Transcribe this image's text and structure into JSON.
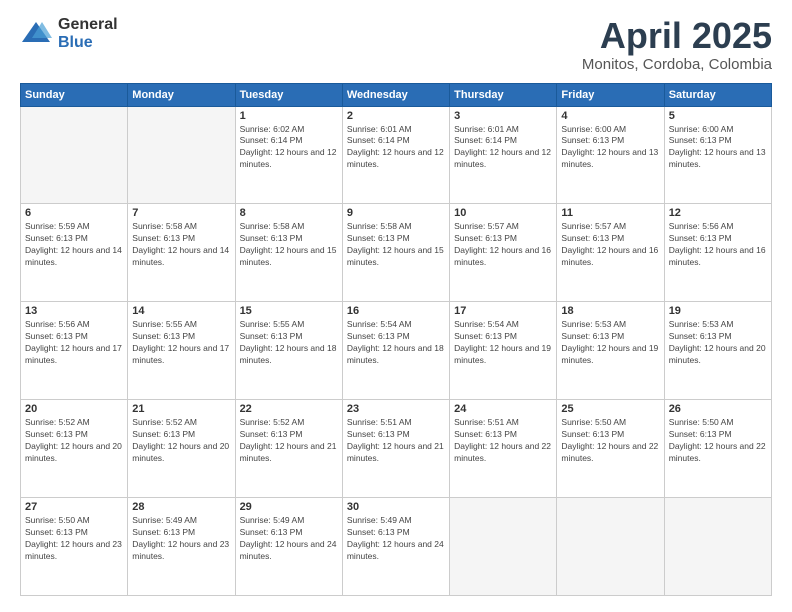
{
  "logo": {
    "general": "General",
    "blue": "Blue"
  },
  "header": {
    "month": "April 2025",
    "location": "Monitos, Cordoba, Colombia"
  },
  "weekdays": [
    "Sunday",
    "Monday",
    "Tuesday",
    "Wednesday",
    "Thursday",
    "Friday",
    "Saturday"
  ],
  "days": [
    {
      "date": "",
      "sunrise": "",
      "sunset": "",
      "daylight": ""
    },
    {
      "date": "",
      "sunrise": "",
      "sunset": "",
      "daylight": ""
    },
    {
      "date": "1",
      "sunrise": "Sunrise: 6:02 AM",
      "sunset": "Sunset: 6:14 PM",
      "daylight": "Daylight: 12 hours and 12 minutes."
    },
    {
      "date": "2",
      "sunrise": "Sunrise: 6:01 AM",
      "sunset": "Sunset: 6:14 PM",
      "daylight": "Daylight: 12 hours and 12 minutes."
    },
    {
      "date": "3",
      "sunrise": "Sunrise: 6:01 AM",
      "sunset": "Sunset: 6:14 PM",
      "daylight": "Daylight: 12 hours and 12 minutes."
    },
    {
      "date": "4",
      "sunrise": "Sunrise: 6:00 AM",
      "sunset": "Sunset: 6:13 PM",
      "daylight": "Daylight: 12 hours and 13 minutes."
    },
    {
      "date": "5",
      "sunrise": "Sunrise: 6:00 AM",
      "sunset": "Sunset: 6:13 PM",
      "daylight": "Daylight: 12 hours and 13 minutes."
    },
    {
      "date": "6",
      "sunrise": "Sunrise: 5:59 AM",
      "sunset": "Sunset: 6:13 PM",
      "daylight": "Daylight: 12 hours and 14 minutes."
    },
    {
      "date": "7",
      "sunrise": "Sunrise: 5:58 AM",
      "sunset": "Sunset: 6:13 PM",
      "daylight": "Daylight: 12 hours and 14 minutes."
    },
    {
      "date": "8",
      "sunrise": "Sunrise: 5:58 AM",
      "sunset": "Sunset: 6:13 PM",
      "daylight": "Daylight: 12 hours and 15 minutes."
    },
    {
      "date": "9",
      "sunrise": "Sunrise: 5:58 AM",
      "sunset": "Sunset: 6:13 PM",
      "daylight": "Daylight: 12 hours and 15 minutes."
    },
    {
      "date": "10",
      "sunrise": "Sunrise: 5:57 AM",
      "sunset": "Sunset: 6:13 PM",
      "daylight": "Daylight: 12 hours and 16 minutes."
    },
    {
      "date": "11",
      "sunrise": "Sunrise: 5:57 AM",
      "sunset": "Sunset: 6:13 PM",
      "daylight": "Daylight: 12 hours and 16 minutes."
    },
    {
      "date": "12",
      "sunrise": "Sunrise: 5:56 AM",
      "sunset": "Sunset: 6:13 PM",
      "daylight": "Daylight: 12 hours and 16 minutes."
    },
    {
      "date": "13",
      "sunrise": "Sunrise: 5:56 AM",
      "sunset": "Sunset: 6:13 PM",
      "daylight": "Daylight: 12 hours and 17 minutes."
    },
    {
      "date": "14",
      "sunrise": "Sunrise: 5:55 AM",
      "sunset": "Sunset: 6:13 PM",
      "daylight": "Daylight: 12 hours and 17 minutes."
    },
    {
      "date": "15",
      "sunrise": "Sunrise: 5:55 AM",
      "sunset": "Sunset: 6:13 PM",
      "daylight": "Daylight: 12 hours and 18 minutes."
    },
    {
      "date": "16",
      "sunrise": "Sunrise: 5:54 AM",
      "sunset": "Sunset: 6:13 PM",
      "daylight": "Daylight: 12 hours and 18 minutes."
    },
    {
      "date": "17",
      "sunrise": "Sunrise: 5:54 AM",
      "sunset": "Sunset: 6:13 PM",
      "daylight": "Daylight: 12 hours and 19 minutes."
    },
    {
      "date": "18",
      "sunrise": "Sunrise: 5:53 AM",
      "sunset": "Sunset: 6:13 PM",
      "daylight": "Daylight: 12 hours and 19 minutes."
    },
    {
      "date": "19",
      "sunrise": "Sunrise: 5:53 AM",
      "sunset": "Sunset: 6:13 PM",
      "daylight": "Daylight: 12 hours and 20 minutes."
    },
    {
      "date": "20",
      "sunrise": "Sunrise: 5:52 AM",
      "sunset": "Sunset: 6:13 PM",
      "daylight": "Daylight: 12 hours and 20 minutes."
    },
    {
      "date": "21",
      "sunrise": "Sunrise: 5:52 AM",
      "sunset": "Sunset: 6:13 PM",
      "daylight": "Daylight: 12 hours and 20 minutes."
    },
    {
      "date": "22",
      "sunrise": "Sunrise: 5:52 AM",
      "sunset": "Sunset: 6:13 PM",
      "daylight": "Daylight: 12 hours and 21 minutes."
    },
    {
      "date": "23",
      "sunrise": "Sunrise: 5:51 AM",
      "sunset": "Sunset: 6:13 PM",
      "daylight": "Daylight: 12 hours and 21 minutes."
    },
    {
      "date": "24",
      "sunrise": "Sunrise: 5:51 AM",
      "sunset": "Sunset: 6:13 PM",
      "daylight": "Daylight: 12 hours and 22 minutes."
    },
    {
      "date": "25",
      "sunrise": "Sunrise: 5:50 AM",
      "sunset": "Sunset: 6:13 PM",
      "daylight": "Daylight: 12 hours and 22 minutes."
    },
    {
      "date": "26",
      "sunrise": "Sunrise: 5:50 AM",
      "sunset": "Sunset: 6:13 PM",
      "daylight": "Daylight: 12 hours and 22 minutes."
    },
    {
      "date": "27",
      "sunrise": "Sunrise: 5:50 AM",
      "sunset": "Sunset: 6:13 PM",
      "daylight": "Daylight: 12 hours and 23 minutes."
    },
    {
      "date": "28",
      "sunrise": "Sunrise: 5:49 AM",
      "sunset": "Sunset: 6:13 PM",
      "daylight": "Daylight: 12 hours and 23 minutes."
    },
    {
      "date": "29",
      "sunrise": "Sunrise: 5:49 AM",
      "sunset": "Sunset: 6:13 PM",
      "daylight": "Daylight: 12 hours and 24 minutes."
    },
    {
      "date": "30",
      "sunrise": "Sunrise: 5:49 AM",
      "sunset": "Sunset: 6:13 PM",
      "daylight": "Daylight: 12 hours and 24 minutes."
    },
    {
      "date": "",
      "sunrise": "",
      "sunset": "",
      "daylight": ""
    },
    {
      "date": "",
      "sunrise": "",
      "sunset": "",
      "daylight": ""
    },
    {
      "date": "",
      "sunrise": "",
      "sunset": "",
      "daylight": ""
    }
  ]
}
